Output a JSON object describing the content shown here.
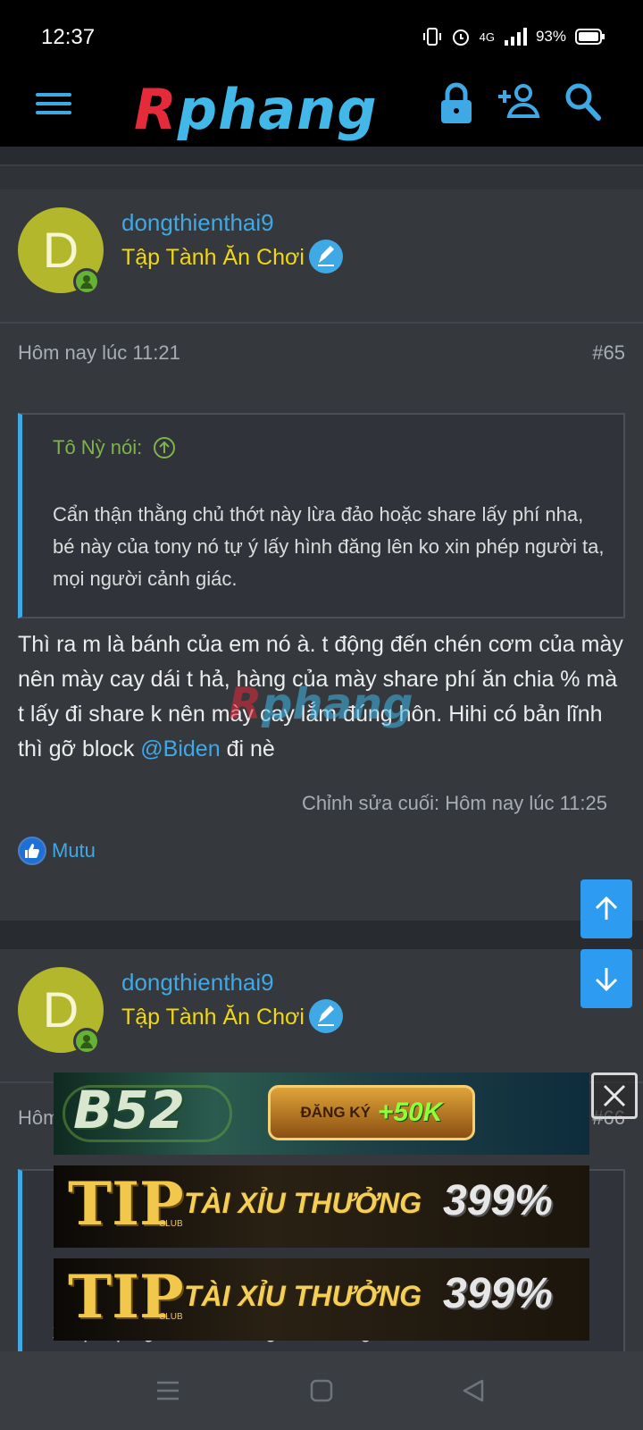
{
  "status": {
    "time": "12:37",
    "network": "4G",
    "battery": "93%"
  },
  "nav": {
    "logo_r": "R",
    "logo_rest": "phang",
    "icons": [
      "menu-icon",
      "lock-icon",
      "add-user-icon",
      "search-icon"
    ]
  },
  "post1": {
    "avatar_letter": "D",
    "username": "dongthienthai9",
    "user_title": "Tập Tành Ăn Chơi",
    "date": "Hôm nay lúc 11:21",
    "post_number": "#65",
    "quote_author": "Tô Nỳ nói:",
    "quote_text": "Cẩn thận thằng chủ thớt này lừa đảo hoặc share lấy phí nha, bé này của tony nó tự ý lấy hình đăng lên ko xin phép người ta, mọi người cảnh giác.",
    "body_before": "Thì ra m là bánh của em nó à. t động đến chén cơm của mày nên mày cay dái t hả, hàng của mày share phí ăn chia % mà t lấy đi share k nên mày cay lắm đúng hôn. Hihi có bản lĩnh thì gỡ block ",
    "mention": "@Biden",
    "body_after": " đi nè",
    "edited": "Chỉnh sửa cuối: Hôm nay lúc 11:25",
    "reaction_user": "Mutu"
  },
  "post2": {
    "avatar_letter": "D",
    "username": "dongthienthai9",
    "user_title": "Tập Tành Ăn Chơi",
    "date": "Hôm",
    "post_number": "#66",
    "quote_visible_line": "xin phép người ta, mọi người cảnh giác."
  },
  "watermark": {
    "r": "R",
    "rest": "phang"
  },
  "ads": {
    "b52": {
      "logo": "B52",
      "button_label": "ĐĂNG KÝ",
      "bonus": "+50K"
    },
    "tip1": {
      "logo": "TIP",
      "club": "CLUB",
      "text": "TÀI XỈU THƯỞNG",
      "percent": "399%"
    },
    "tip2": {
      "logo": "TIP",
      "club": "CLUB",
      "text": "TÀI XỈU THƯỞNG",
      "percent": "399%"
    }
  },
  "colors": {
    "accent": "#3fa9e6",
    "user_title": "#f1d80e",
    "quote_author": "#7fb34b",
    "background": "#2f3338"
  }
}
